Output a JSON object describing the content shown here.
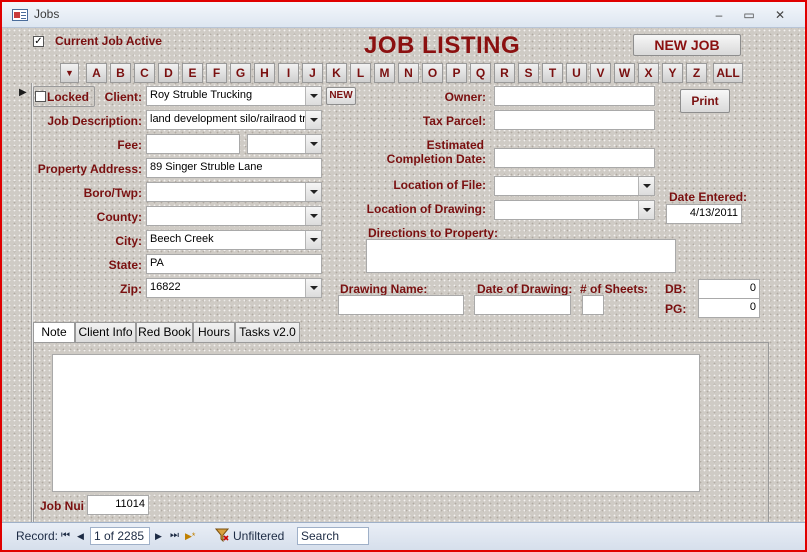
{
  "window": {
    "title": "Jobs",
    "minimize": "–",
    "maximize": "▭",
    "close": "✕"
  },
  "header": {
    "current_job_active_label": "Current Job Active",
    "current_job_active_checked": true,
    "title": "JOB LISTING",
    "new_job_label": "NEW JOB",
    "title_color": "#8b1010"
  },
  "alpha_filter": {
    "dropdown": "▼",
    "letters": [
      "A",
      "B",
      "C",
      "D",
      "E",
      "F",
      "G",
      "H",
      "I",
      "J",
      "K",
      "L",
      "M",
      "N",
      "O",
      "P",
      "Q",
      "R",
      "S",
      "T",
      "U",
      "V",
      "W",
      "X",
      "Y",
      "Z"
    ],
    "all_label": "ALL"
  },
  "record_selector": "▶",
  "left_fields": {
    "locked_label": "Locked",
    "client_label": "Client:",
    "client_value": "Roy Struble Trucking",
    "new_client_label": "NEW",
    "job_description_label": "Job Description:",
    "job_description_value": "land development silo/railraod tra",
    "fee_label": "Fee:",
    "fee_value": "",
    "fee_type_value": "",
    "property_address_label": "Property Address:",
    "property_address_value": "89 Singer Struble Lane",
    "boro_twp_label": "Boro/Twp:",
    "boro_twp_value": "",
    "county_label": "County:",
    "county_value": "",
    "city_label": "City:",
    "city_value": "Beech Creek",
    "state_label": "State:",
    "state_value": "PA",
    "zip_label": "Zip:",
    "zip_value": "16822"
  },
  "right_fields": {
    "owner_label": "Owner:",
    "owner_value": "",
    "tax_parcel_label": "Tax Parcel:",
    "tax_parcel_value": "",
    "estimated_label": "Estimated",
    "completion_date_label": "Completion Date:",
    "completion_date_value": "",
    "location_of_file_label": "Location of File:",
    "location_of_file_value": "",
    "location_of_drawing_label": "Location of Drawing:",
    "location_of_drawing_value": "",
    "print_label": "Print",
    "date_entered_label": "Date Entered:",
    "date_entered_value": "4/13/2011",
    "directions_label": "Directions to Property:",
    "directions_value": "",
    "drawing_name_label": "Drawing Name:",
    "drawing_name_value": "",
    "date_of_drawing_label": "Date of Drawing:",
    "date_of_drawing_value": "",
    "sheets_label": "# of Sheets:",
    "sheets_value": "",
    "db_label": "DB:",
    "db_value": "0",
    "pg_label": "PG:",
    "pg_value": "0"
  },
  "tabs": [
    {
      "label": "Note",
      "active": true
    },
    {
      "label": "Client Info",
      "active": false
    },
    {
      "label": "Red Book",
      "active": false
    },
    {
      "label": "Hours",
      "active": false
    },
    {
      "label": "Tasks v2.0",
      "active": false
    }
  ],
  "note": {
    "note_value": "",
    "job_num_label": "Job Nui",
    "job_num_value": "11014"
  },
  "record_nav": {
    "record_label": "Record:",
    "first": "⏮",
    "prev": "◀",
    "position": "1 of 2285",
    "next": "▶",
    "last": "⏭",
    "new": "▶*",
    "filter_label": "Unfiltered",
    "search_placeholder": "Search"
  }
}
